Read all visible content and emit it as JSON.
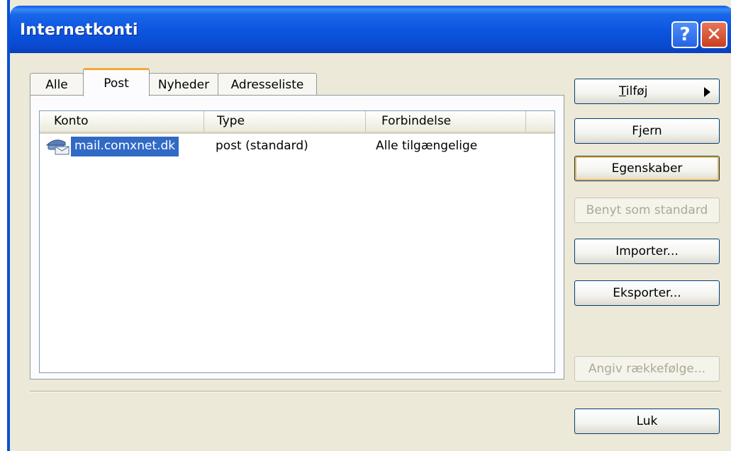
{
  "window": {
    "title": "Internetkonti",
    "help_label": "?",
    "close_label": "✕"
  },
  "tabs": [
    {
      "label": "Alle",
      "active": false
    },
    {
      "label": "Post",
      "active": true
    },
    {
      "label": "Nyheder",
      "active": false
    },
    {
      "label": "Adresseliste",
      "active": false
    }
  ],
  "list": {
    "columns": [
      "Konto",
      "Type",
      "Forbindelse"
    ],
    "rows": [
      {
        "account": "mail.comxnet.dk",
        "type": "post (standard)",
        "connection": "Alle tilgængelige",
        "selected": true,
        "icon": "mail-account-icon"
      }
    ]
  },
  "buttons": {
    "add": "Tilføj",
    "remove": "Fjern",
    "properties": "Egenskaber",
    "set_default": "Benyt som standard",
    "import": "Importer...",
    "export": "Eksporter...",
    "order": "Angiv rækkefølge...",
    "close": "Luk"
  },
  "colors": {
    "titlebar": "#0a54df",
    "dialog_bg": "#ece9d8",
    "selection": "#316ac5",
    "active_tab_accent": "#f4a83a",
    "close_button": "#c9401f"
  }
}
